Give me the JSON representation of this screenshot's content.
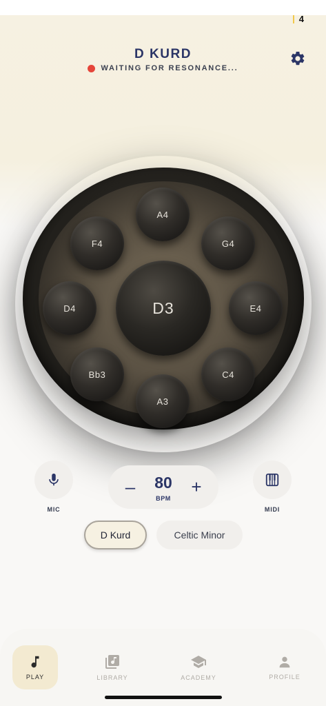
{
  "status_bar": {
    "signal": "4"
  },
  "header": {
    "title": "D KURD",
    "status_text": "WAITING FOR RESONANCE...",
    "status_color": "#e5453a",
    "settings_icon": "gear-icon"
  },
  "drum": {
    "center": "D3",
    "notes": {
      "top": "A4",
      "upper_left": "F4",
      "upper_right": "G4",
      "left": "D4",
      "right": "E4",
      "lower_left": "Bb3",
      "lower_right": "C4",
      "bottom": "A3"
    }
  },
  "controls": {
    "mic_label": "MIC",
    "mic_icon": "microphone-icon",
    "midi_label": "MIDI",
    "midi_icon": "piano-keys-icon",
    "bpm_value": "80",
    "bpm_unit": "BPM",
    "minus_label": "–",
    "plus_label": "+"
  },
  "scales": {
    "selected": "D Kurd",
    "other": "Celtic Minor"
  },
  "nav": {
    "items": [
      {
        "label": "PLAY",
        "icon": "music-note-icon",
        "active": true
      },
      {
        "label": "LIBRARY",
        "icon": "library-icon",
        "active": false
      },
      {
        "label": "ACADEMY",
        "icon": "graduation-cap-icon",
        "active": false
      },
      {
        "label": "PROFILE",
        "icon": "person-icon",
        "active": false
      }
    ]
  },
  "colors": {
    "accent": "#2b3566",
    "cream": "#f6f1e2",
    "drum_dark": "#23211d"
  }
}
